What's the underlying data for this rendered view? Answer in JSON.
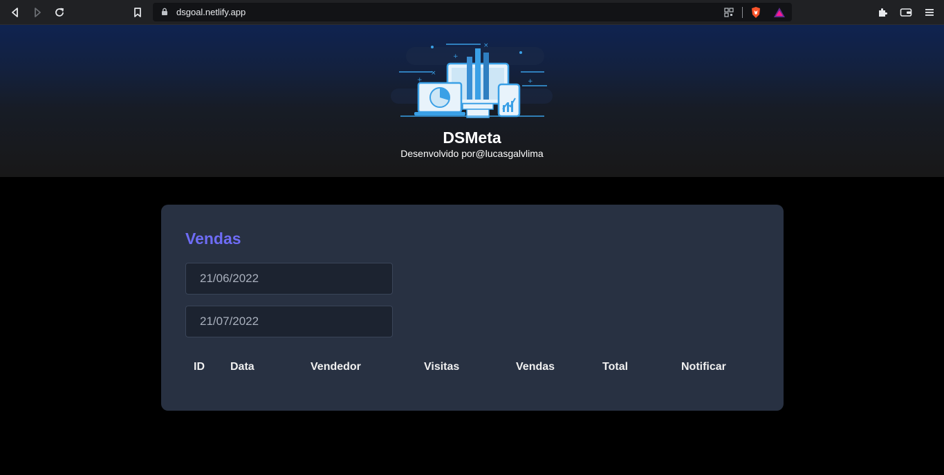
{
  "browser": {
    "url": "dsgoal.netlify.app"
  },
  "header": {
    "title": "DSMeta",
    "subtitle": "Desenvolvido por@lucasgalvlima"
  },
  "card": {
    "title": "Vendas",
    "start_date": "21/06/2022",
    "end_date": "21/07/2022",
    "columns": [
      "ID",
      "Data",
      "Vendedor",
      "Visitas",
      "Vendas",
      "Total",
      "Notificar"
    ]
  },
  "colors": {
    "accent": "#6e6cf5",
    "card_bg": "#283142",
    "page_bg": "#000000",
    "input_bg": "#1c2330"
  }
}
